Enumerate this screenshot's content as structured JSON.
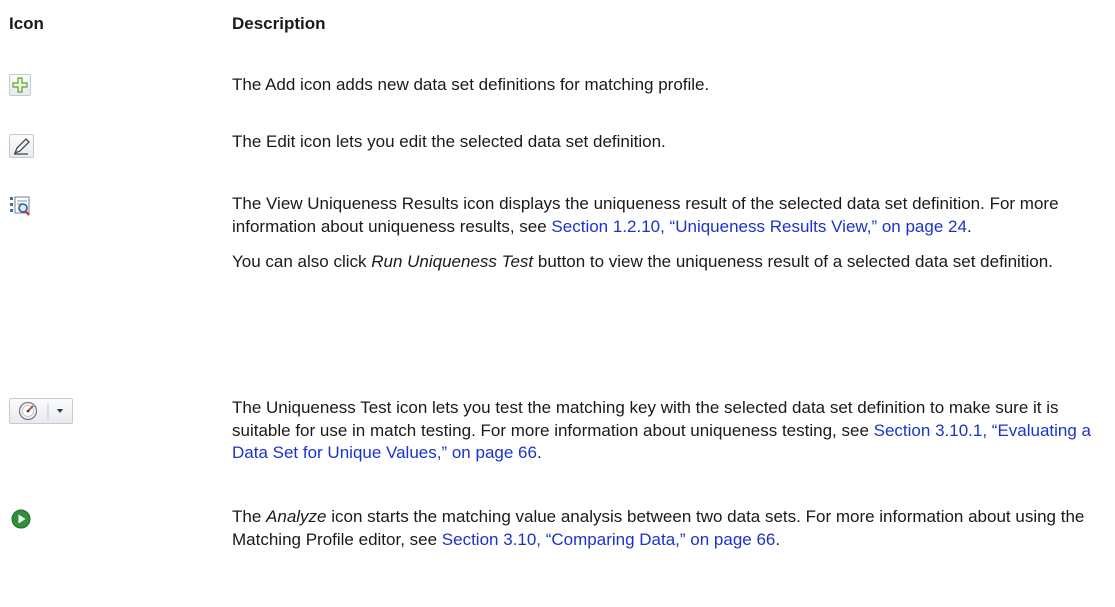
{
  "headers": {
    "icon": "Icon",
    "description": "Description"
  },
  "rows": [
    {
      "icon": "add-icon",
      "text": "The Add icon adds new data set definitions for matching profile."
    },
    {
      "icon": "edit-pencil-icon",
      "text": "The Edit icon lets you edit the selected data set definition."
    },
    {
      "icon": "view-uniqueness-results-icon",
      "text_before": "The View Uniqueness Results icon displays the uniqueness result of the selected data set definition. For more information about uniqueness results, see ",
      "link": "Section 1.2.10, “Uniqueness Results View,” on page 24",
      "text_after": ".",
      "extra_before": "You can also click ",
      "extra_em": "Run Uniqueness Test",
      "extra_after": " button to view the uniqueness result of a selected data set definition."
    },
    {
      "icon": "uniqueness-test-gauge-icon",
      "text_before": "The Uniqueness Test icon lets you test the matching key with the selected data set definition to make sure it is suitable for use in match testing. For more information about uniqueness testing, see ",
      "link": "Section 3.10.1, “Evaluating a Data Set for Unique Values,” on page 66",
      "text_after": "."
    },
    {
      "icon": "analyze-play-icon",
      "text_before": "The ",
      "em": "Analyze",
      "text_mid": " icon starts the matching value analysis between two data sets. For more information about using the Matching Profile editor, see ",
      "link": "Section 3.10, “Comparing Data,” on page 66",
      "text_after": "."
    }
  ]
}
